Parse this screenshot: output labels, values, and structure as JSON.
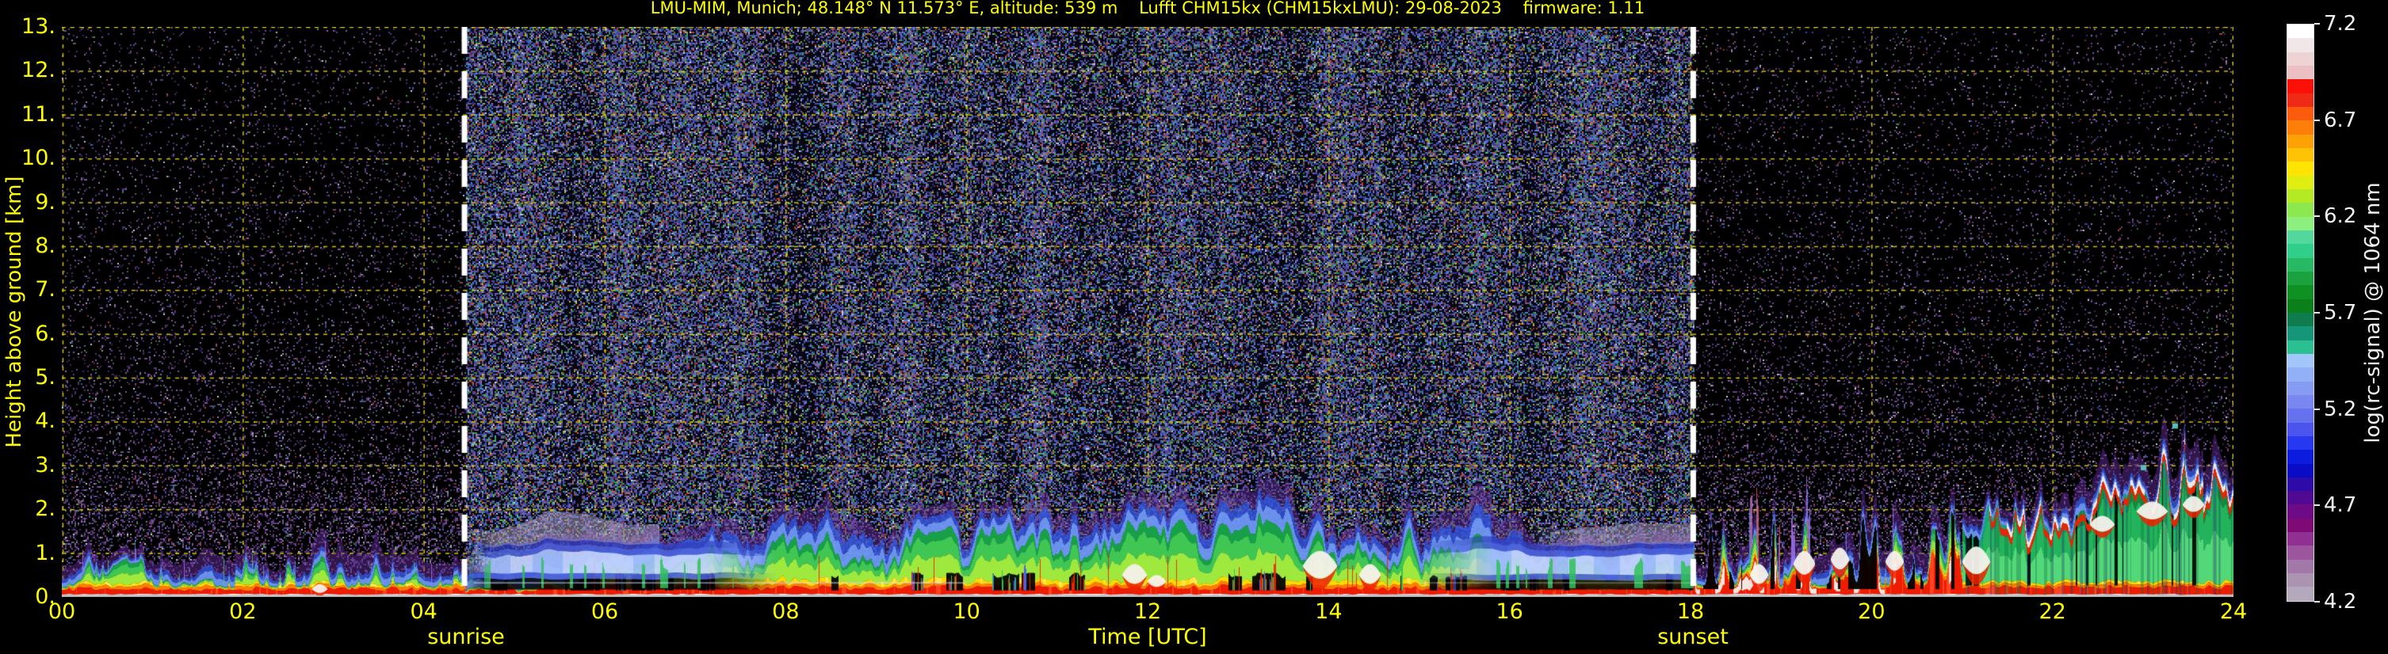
{
  "title": "LMU-MIM, Munich; 48.148° N 11.573° E, altitude: 539 m    Lufft CHM15kx (CHM15kxLMU): 29-08-2023    firmware: 1.11",
  "axes": {
    "x_label": "Time [UTC]",
    "y_label": "Height above ground [km]",
    "x_ticks": [
      "00",
      "02",
      "04",
      "06",
      "08",
      "10",
      "12",
      "14",
      "16",
      "18",
      "20",
      "22",
      "24"
    ],
    "y_ticks": [
      "0.",
      "1.",
      "2.",
      "3.",
      "4.",
      "5.",
      "6.",
      "7.",
      "8.",
      "9.",
      "10.",
      "11.",
      "12.",
      "13."
    ],
    "sunrise_label": "sunrise",
    "sunset_label": "sunset"
  },
  "colorbar": {
    "label": "log(rc-signal) @ 1064 nm",
    "ticks": [
      "7.2",
      "6.7",
      "6.2",
      "5.7",
      "5.2",
      "4.7",
      "4.2"
    ],
    "range": [
      4.2,
      7.2
    ],
    "colors_top_to_bottom": [
      "#ffffff",
      "#f1e7e9",
      "#eed3d5",
      "#ecbfc3",
      "#fb1007",
      "#ef2b16",
      "#fc5a0c",
      "#fd7e08",
      "#fda206",
      "#fdc304",
      "#fde402",
      "#dfee10",
      "#b4ea24",
      "#8ce84e",
      "#8df07e",
      "#52d89c",
      "#2fcf8a",
      "#27b964",
      "#1ba23f",
      "#0e9122",
      "#0b7f1a",
      "#0e7c4c",
      "#169678",
      "#2cbf92",
      "#a2c6fa",
      "#92b0f6",
      "#869cf2",
      "#7a87f0",
      "#6671ee",
      "#4b55ee",
      "#2738f0",
      "#0b1cdf",
      "#0a0bc4",
      "#2d0ba8",
      "#500a92",
      "#6e0a86",
      "#7e0a76",
      "#903092",
      "#9c569e",
      "#a278a8",
      "#aa94b2",
      "#b4a8bc"
    ]
  },
  "chart_data": {
    "type": "heatmap",
    "title": "Ceilometer attenuated backscatter, Lufft CHM15kx, Munich, 29-08-2023",
    "xlabel": "Time [UTC]",
    "ylabel": "Height above ground [km]",
    "xlim": [
      0,
      24
    ],
    "ylim": [
      0,
      13
    ],
    "value_label": "log(rc-signal) @ 1064 nm",
    "value_range": [
      4.2,
      7.2
    ],
    "grid": true,
    "grid_color": "#e8d200",
    "dayline_color": "#ffffff",
    "sunrise_utc": 4.45,
    "sunset_utc": 18.03,
    "layer_top_km": {
      "t": [
        0,
        0.8,
        1.5,
        2,
        3,
        4,
        4.45,
        5,
        6,
        7,
        8,
        9,
        10,
        11,
        12,
        13,
        14,
        15,
        16,
        17,
        18,
        19,
        20,
        21,
        22,
        23,
        23.6,
        24
      ],
      "km": [
        0.55,
        0.9,
        0.5,
        0.55,
        0.6,
        0.55,
        0.6,
        1.0,
        1.1,
        1.15,
        1.35,
        1.5,
        1.55,
        1.7,
        1.6,
        1.65,
        1.75,
        1.45,
        1.25,
        1.3,
        1.35,
        1.5,
        1.45,
        1.55,
        1.9,
        2.3,
        2.9,
        3.2
      ]
    },
    "residual_layer_windows": [
      {
        "t_start": 4.45,
        "t_end": 7.9,
        "base_km": 0.42,
        "top_km": 1.0
      },
      {
        "t_start": 15.0,
        "t_end": 18.03,
        "base_km": 0.4,
        "top_km": 1.0
      }
    ],
    "cloud_band": {
      "t_start": 21.3,
      "t_end": 24,
      "km_start": 1.4,
      "km_end": 2.15
    },
    "bright_cells": [
      [
        2.85,
        0.18,
        10,
        0.22
      ],
      [
        11.85,
        0.5,
        16,
        0.5
      ],
      [
        12.1,
        0.35,
        12,
        0.3
      ],
      [
        13.9,
        0.7,
        22,
        0.7
      ],
      [
        14.45,
        0.5,
        14,
        0.5
      ],
      [
        18.75,
        0.5,
        12,
        0.5
      ],
      [
        19.25,
        0.75,
        14,
        0.6
      ],
      [
        19.65,
        0.85,
        12,
        0.55
      ],
      [
        20.25,
        0.8,
        12,
        0.5
      ],
      [
        21.15,
        0.8,
        18,
        0.7
      ],
      [
        22.55,
        1.65,
        16,
        0.4
      ],
      [
        23.1,
        1.95,
        20,
        0.45
      ],
      [
        23.55,
        2.1,
        14,
        0.4
      ]
    ],
    "cloud_blips": [
      [
        23.0,
        2.95
      ],
      [
        23.35,
        3.9
      ]
    ],
    "overlap_line_km": 0.34,
    "noise": {
      "night_purple": [
        "#7b4fa0",
        "#5d3b85",
        "#8a62b0",
        "#4a2f70",
        "#9a7ac0"
      ],
      "night_rare": [
        "#3b6fd8",
        "#b84444",
        "#44aa55",
        "#d8d8e8"
      ],
      "day_purple": [
        "#7a5fae",
        "#68519e",
        "#8d74c2"
      ],
      "day_blue": [
        "#4a63d8",
        "#5d7ae8",
        "#3648b8",
        "#6f8af0"
      ],
      "day_green": [
        "#3aa84e",
        "#56c860"
      ],
      "day_red": [
        "#c84038",
        "#e06030"
      ],
      "day_cyan": "#3fa8d8",
      "day_yellow": "#c8c040",
      "day_white": "#d8d8ec"
    }
  }
}
